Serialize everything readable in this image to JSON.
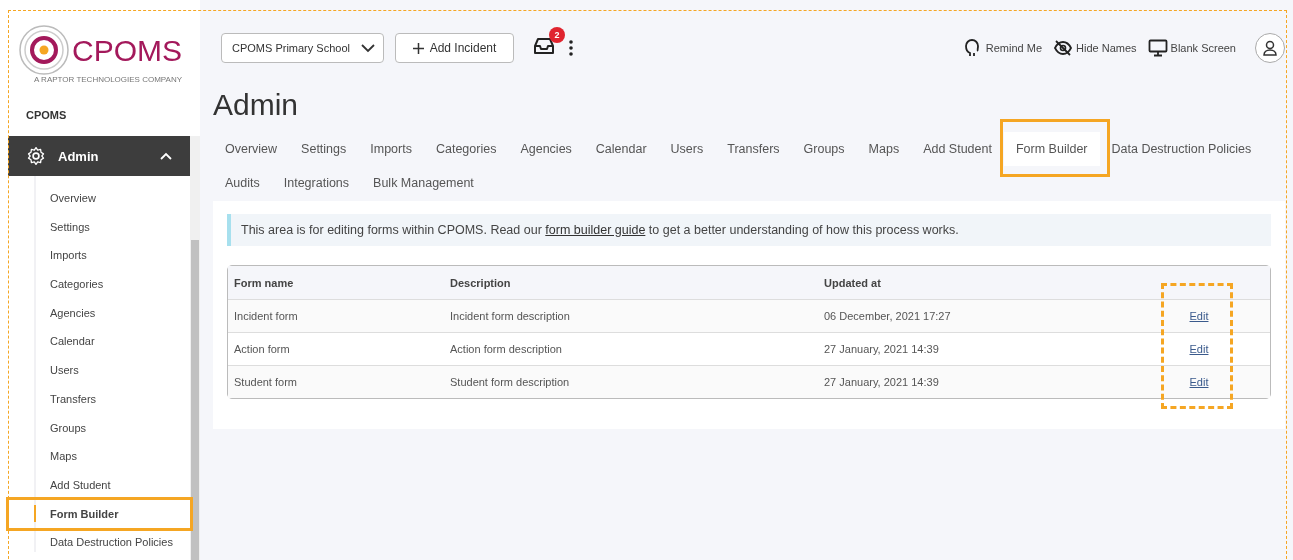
{
  "logo": {
    "text": "CPOMS",
    "tagline": "A RAPTOR TECHNOLOGIES COMPANY"
  },
  "sidebar": {
    "heading": "CPOMS",
    "section": {
      "label": "Admin",
      "expanded": true
    },
    "items": [
      {
        "label": "Overview",
        "selected": false
      },
      {
        "label": "Settings",
        "selected": false
      },
      {
        "label": "Imports",
        "selected": false
      },
      {
        "label": "Categories",
        "selected": false
      },
      {
        "label": "Agencies",
        "selected": false
      },
      {
        "label": "Calendar",
        "selected": false
      },
      {
        "label": "Users",
        "selected": false
      },
      {
        "label": "Transfers",
        "selected": false
      },
      {
        "label": "Groups",
        "selected": false
      },
      {
        "label": "Maps",
        "selected": false
      },
      {
        "label": "Add Student",
        "selected": false
      },
      {
        "label": "Form Builder",
        "selected": true
      },
      {
        "label": "Data Destruction Policies",
        "selected": false
      }
    ]
  },
  "topbar": {
    "school_select": "CPOMS Primary School",
    "add_button": "Add Incident",
    "inbox_badge": "2",
    "actions": [
      {
        "kind": "remind",
        "label": "Remind Me"
      },
      {
        "kind": "hide",
        "label": "Hide Names"
      },
      {
        "kind": "blank",
        "label": "Blank Screen"
      }
    ]
  },
  "title": "Admin",
  "tabs": [
    {
      "label": "Overview",
      "selected": false
    },
    {
      "label": "Settings",
      "selected": false
    },
    {
      "label": "Imports",
      "selected": false
    },
    {
      "label": "Categories",
      "selected": false
    },
    {
      "label": "Agencies",
      "selected": false
    },
    {
      "label": "Calendar",
      "selected": false
    },
    {
      "label": "Users",
      "selected": false
    },
    {
      "label": "Transfers",
      "selected": false
    },
    {
      "label": "Groups",
      "selected": false
    },
    {
      "label": "Maps",
      "selected": false
    },
    {
      "label": "Add Student",
      "selected": false
    },
    {
      "label": "Form Builder",
      "selected": true
    },
    {
      "label": "Data Destruction Policies",
      "selected": false
    },
    {
      "label": "Audits",
      "selected": false
    },
    {
      "label": "Integrations",
      "selected": false
    },
    {
      "label": "Bulk Management",
      "selected": false
    }
  ],
  "alert": {
    "before": "This area is for editing forms within CPOMS. Read our",
    "link": "form builder guide",
    "after": "to get a better understanding of how this process works."
  },
  "table": {
    "columns": [
      "Form name",
      "Description",
      "Updated at"
    ],
    "edit_column_highlighted": true,
    "rows": [
      {
        "name": "Incident form",
        "description": "Incident form description",
        "updated": "06 December, 2021 17:27",
        "action": "Edit"
      },
      {
        "name": "Action form",
        "description": "Action form description",
        "updated": "27 January, 2021 14:39",
        "action": "Edit"
      },
      {
        "name": "Student form",
        "description": "Student form description",
        "updated": "27 January, 2021 14:39",
        "action": "Edit"
      }
    ]
  }
}
